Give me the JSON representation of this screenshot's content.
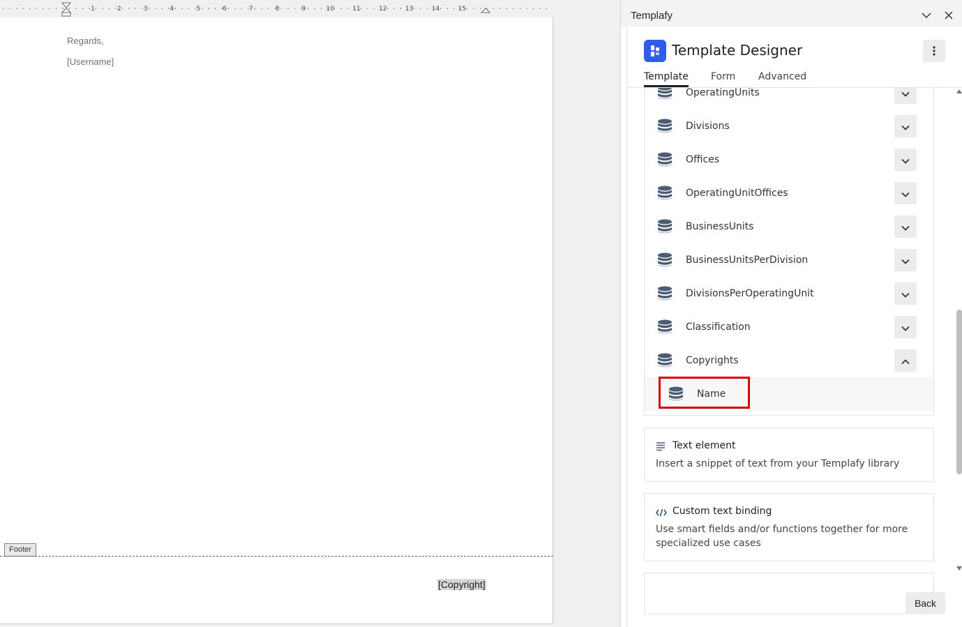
{
  "ruler": {
    "numbers": [
      "1",
      "2",
      "3",
      "4",
      "5",
      "6",
      "7",
      "8",
      "9",
      "10",
      "11",
      "12",
      "13",
      "14",
      "15"
    ]
  },
  "document": {
    "line1": "Regards,",
    "line2": "[Username]",
    "footer_tag": "Footer",
    "copyright_field": "[Copyright]"
  },
  "panel": {
    "app_name": "Templafy",
    "title": "Template Designer",
    "tabs": [
      {
        "label": "Template",
        "active": true
      },
      {
        "label": "Form",
        "active": false
      },
      {
        "label": "Advanced",
        "active": false
      }
    ],
    "data_sources": [
      {
        "label": "OperatingUnits",
        "expanded": false
      },
      {
        "label": "Divisions",
        "expanded": false
      },
      {
        "label": "Offices",
        "expanded": false
      },
      {
        "label": "OperatingUnitOffices",
        "expanded": false
      },
      {
        "label": "BusinessUnits",
        "expanded": false
      },
      {
        "label": "BusinessUnitsPerDivision",
        "expanded": false
      },
      {
        "label": "DivisionsPerOperatingUnit",
        "expanded": false
      },
      {
        "label": "Classification",
        "expanded": false
      },
      {
        "label": "Copyrights",
        "expanded": true
      }
    ],
    "sub_field": "Name",
    "cards": [
      {
        "title": "Text element",
        "desc": "Insert a snippet of text from your Templafy library",
        "icon": "lines-icon"
      },
      {
        "title": "Custom text binding",
        "desc": "Use smart fields and/or functions together for more specialized use cases",
        "icon": "code-icon"
      }
    ],
    "back_label": "Back",
    "colors": {
      "logo": "#2d5ded",
      "highlight": "#d40000",
      "db_icon": "#4b5d74"
    }
  }
}
